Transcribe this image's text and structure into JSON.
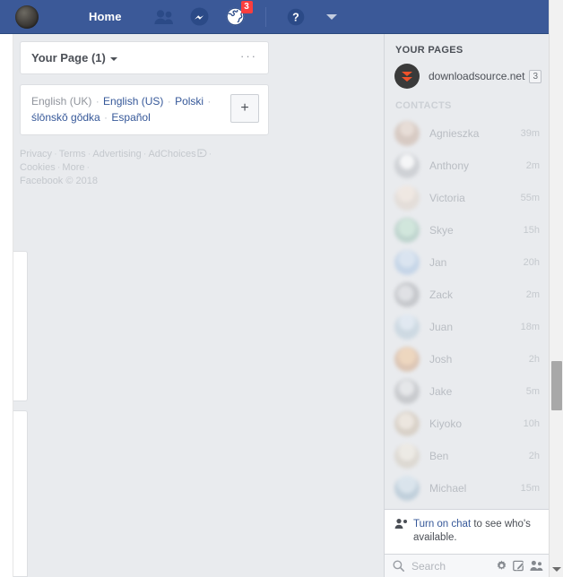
{
  "topbar": {
    "avatar_name": "profile-avatar",
    "home_label": "Home",
    "icons": [
      {
        "name": "friend-requests-icon",
        "glyph": "friends"
      },
      {
        "name": "messages-icon",
        "glyph": "messenger"
      },
      {
        "name": "notifications-icon",
        "glyph": "globe",
        "badge": "3"
      },
      {
        "name": "help-icon",
        "glyph": "question"
      },
      {
        "name": "account-menu-icon",
        "glyph": "caret-down"
      }
    ],
    "notifications_badge": "3"
  },
  "left_column": {
    "page_card": {
      "title": "Your Page (1)",
      "more_label": "···"
    },
    "language_card": {
      "languages": [
        {
          "label": "English (UK)",
          "active": true
        },
        {
          "label": "English (US)",
          "active": false
        },
        {
          "label": "Polski",
          "active": false
        },
        {
          "label": "ślōnskŏ gŏdka",
          "active": false
        },
        {
          "label": "Español",
          "active": false
        }
      ],
      "add_language_label": "+"
    },
    "footer": {
      "links": [
        "Privacy",
        "Terms",
        "Advertising",
        "AdChoices",
        "Cookies",
        "More"
      ],
      "copyright": "Facebook © 2018"
    }
  },
  "right_rail": {
    "your_pages_title": "YOUR PAGES",
    "pages": [
      {
        "name": "downloadsource.net",
        "badge": "3"
      }
    ],
    "contacts_title": "CONTACTS",
    "contacts": [
      {
        "name": "Agnieszka",
        "time": "39m"
      },
      {
        "name": "Anthony",
        "time": "2m"
      },
      {
        "name": "Victoria",
        "time": "55m"
      },
      {
        "name": "Skye",
        "time": "15h"
      },
      {
        "name": "Jan",
        "time": "20h"
      },
      {
        "name": "Zack",
        "time": "2m"
      },
      {
        "name": "Juan",
        "time": "18m"
      },
      {
        "name": "Josh",
        "time": "2h"
      },
      {
        "name": "Jake",
        "time": "5m"
      },
      {
        "name": "Kiyoko",
        "time": "10h"
      },
      {
        "name": "Ben",
        "time": "2h"
      },
      {
        "name": "Michael",
        "time": "15m"
      }
    ],
    "chat_note": {
      "link_label": "Turn on chat",
      "rest_text": " to see who's available."
    },
    "chat_search": {
      "placeholder": "Search",
      "settings_label": "chat-settings",
      "compose_label": "new-message",
      "friends_label": "friend-list"
    }
  },
  "colors": {
    "facebook_blue": "#3b5998",
    "link_blue": "#365899",
    "badge_red": "#fa3e3e",
    "page_bg": "#e9ebee",
    "brand_orange": "#f0522a"
  }
}
